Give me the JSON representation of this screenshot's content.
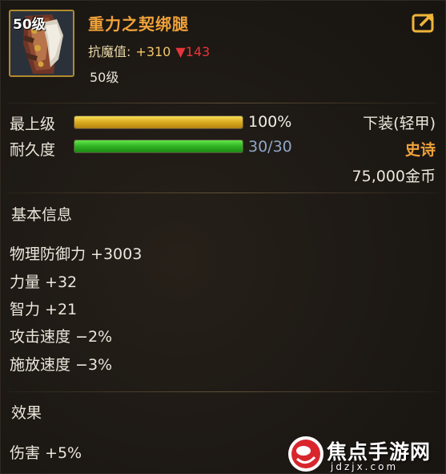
{
  "item": {
    "level_badge": "50级",
    "name": "重力之契绑腿",
    "magic_resist_label": "抗魔值:",
    "magic_resist_plus": "+310",
    "magic_resist_down": "▼143",
    "required_level": "50级",
    "icon": "armored-leggings-icon"
  },
  "bars": {
    "max_level": {
      "label": "最上级",
      "value_text": "100%",
      "fraction": 1.0
    },
    "durability": {
      "label": "耐久度",
      "value_text": "30/30",
      "fraction": 1.0
    }
  },
  "meta": {
    "slot": "下装(轻甲)",
    "rarity": "史诗",
    "price": "75,000金币"
  },
  "basic_info": {
    "title": "基本信息",
    "stats": [
      "物理防御力 +3003",
      "力量 +32",
      "智力 +21",
      "攻击速度 −2%",
      "施放速度 −3%"
    ]
  },
  "effects": {
    "title": "效果",
    "stats": [
      "伤害 +5%"
    ]
  },
  "watermark": {
    "text": "焦点手游网",
    "url": "jdzjx.com"
  },
  "colors": {
    "name": "#f0a23a",
    "rarity": "#f0a23a",
    "resist_down": "#e8343a",
    "durability_text": "#8fa7c6"
  }
}
